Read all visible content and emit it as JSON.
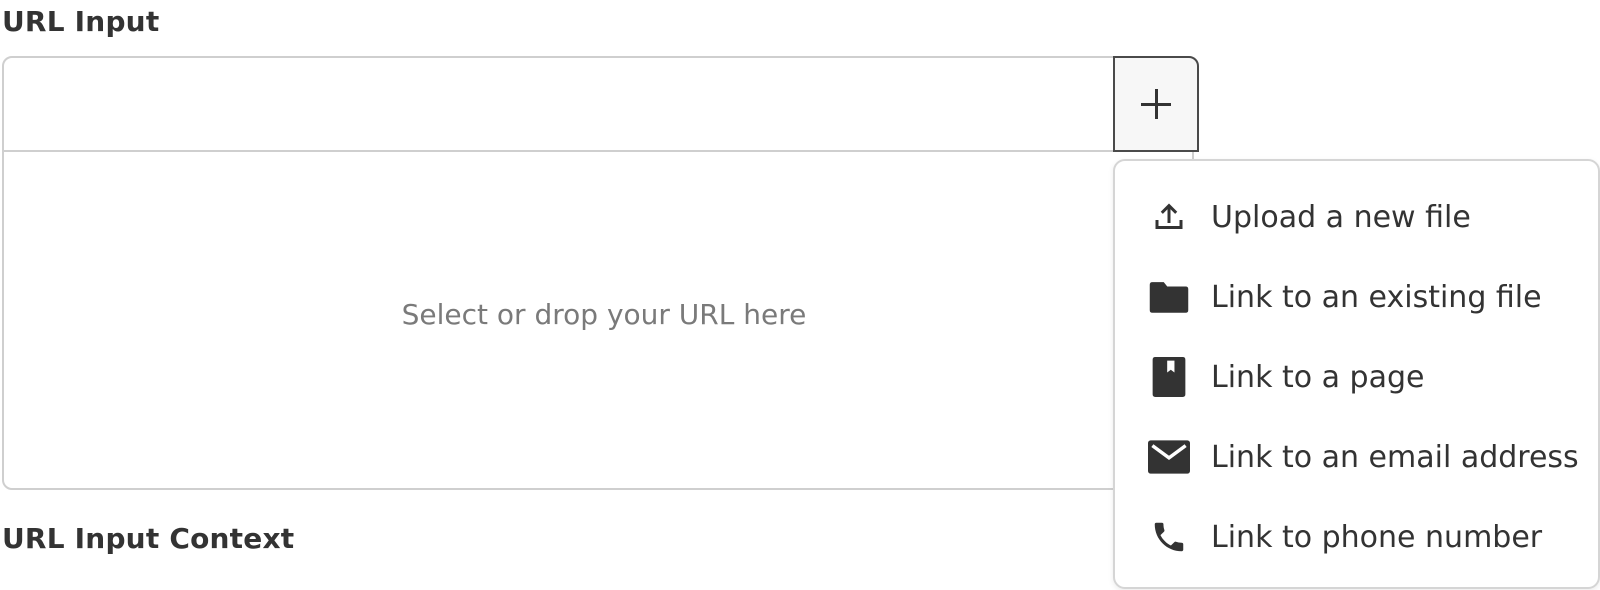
{
  "labels": {
    "url_input": "URL Input",
    "url_input_context": "URL Input Context"
  },
  "url_input": {
    "value": "",
    "placeholder": "",
    "drop_text": "Select or drop your URL here"
  },
  "add_button": {
    "icon": "plus-icon",
    "expanded": true
  },
  "menu": {
    "items": [
      {
        "label": "Upload a new file",
        "icon": "upload-icon"
      },
      {
        "label": "Link to an existing file",
        "icon": "folder-icon"
      },
      {
        "label": "Link to a page",
        "icon": "page-icon"
      },
      {
        "label": "Link to an email address",
        "icon": "envelope-icon"
      },
      {
        "label": "Link to phone number",
        "icon": "phone-icon"
      }
    ]
  },
  "colors": {
    "border": "#cfcfcf",
    "text": "#333333",
    "muted_text": "#7a7a7a",
    "button_border": "#4a4a4a"
  }
}
